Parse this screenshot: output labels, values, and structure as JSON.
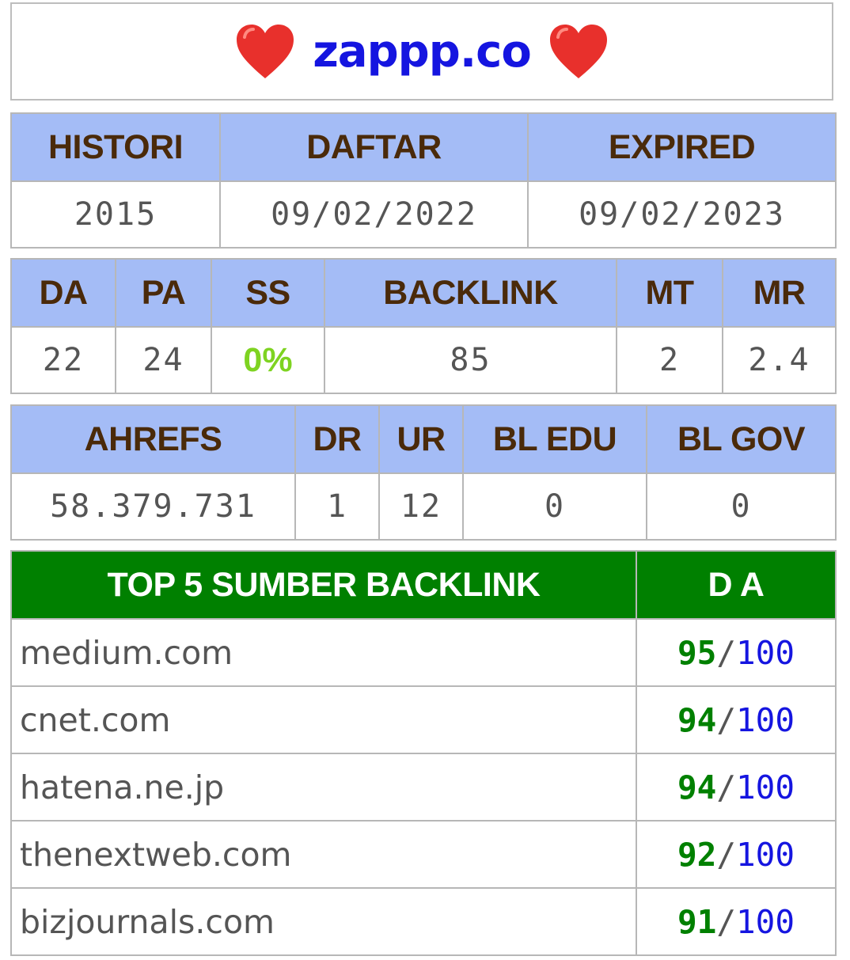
{
  "header": {
    "domain": "zappp.co",
    "left_icon": "heart-icon",
    "right_icon": "heart-icon",
    "heart_color": "#e8302c",
    "title_color": "#1515e0"
  },
  "registration_table": {
    "headers": [
      "HISTORI",
      "DAFTAR",
      "EXPIRED"
    ],
    "values": [
      "2015",
      "09/02/2022",
      "09/02/2023"
    ]
  },
  "moz_table": {
    "headers": [
      "DA",
      "PA",
      "SS",
      "BACKLINK",
      "MT",
      "MR"
    ],
    "values": [
      "22",
      "24",
      "0%",
      "85",
      "2",
      "2.4"
    ],
    "ss_color": "#7ed321"
  },
  "ahrefs_table": {
    "headers": [
      "AHREFS",
      "DR",
      "UR",
      "BL EDU",
      "BL GOV"
    ],
    "values": [
      "58.379.731",
      "1",
      "12",
      "0",
      "0"
    ]
  },
  "backlinks_table": {
    "headers": [
      "TOP 5 SUMBER BACKLINK",
      "D A"
    ],
    "rows": [
      {
        "site": "medium.com",
        "score": "95",
        "separator": "/",
        "max": "100"
      },
      {
        "site": "cnet.com",
        "score": "94",
        "separator": "/",
        "max": "100"
      },
      {
        "site": "hatena.ne.jp",
        "score": "94",
        "separator": "/",
        "max": "100"
      },
      {
        "site": "thenextweb.com",
        "score": "92",
        "separator": "/",
        "max": "100"
      },
      {
        "site": "bizjournals.com",
        "score": "91",
        "separator": "/",
        "max": "100"
      }
    ],
    "header_color": "#008000"
  },
  "colors": {
    "header_blue": "#a4bcf6",
    "header_text": "#4a2a0a",
    "border": "#b7b7b7"
  }
}
